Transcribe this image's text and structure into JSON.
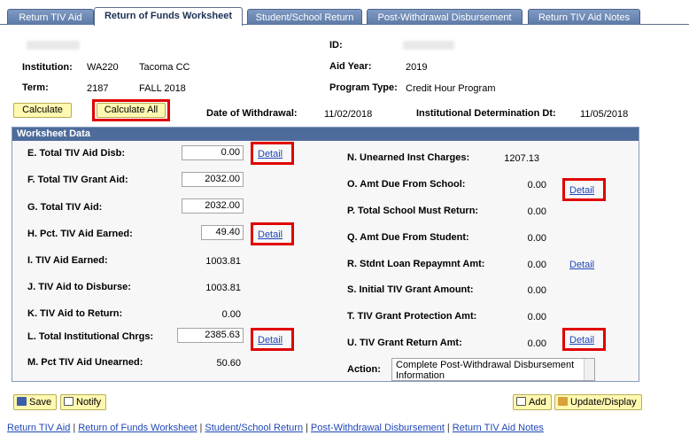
{
  "tabs": [
    {
      "label": "Return TIV Aid",
      "active": false
    },
    {
      "label": "Return of Funds Worksheet",
      "active": true
    },
    {
      "label": "Student/School Return",
      "active": false
    },
    {
      "label": "Post-Withdrawal Disbursement",
      "active": false
    },
    {
      "label": "Return TIV Aid Notes",
      "active": false
    }
  ],
  "header": {
    "id_label": "ID:",
    "institution_label": "Institution:",
    "institution_code": "WA220",
    "institution_name": "Tacoma CC",
    "aid_year_label": "Aid Year:",
    "aid_year": "2019",
    "term_label": "Term:",
    "term_code": "2187",
    "term_name": "FALL 2018",
    "program_type_label": "Program Type:",
    "program_type": "Credit Hour Program",
    "calculate_label": "Calculate",
    "calculate_all_label": "Calculate All",
    "withdrawal_label": "Date of Withdrawal:",
    "withdrawal_date": "11/02/2018",
    "inst_det_label": "Institutional Determination Dt:",
    "inst_det_date": "11/05/2018"
  },
  "worksheet": {
    "title": "Worksheet Data",
    "detail_label": "Detail",
    "E_label": "E. Total TIV Aid Disb:",
    "E_value": "0.00",
    "F_label": "F. Total TIV Grant Aid:",
    "F_value": "2032.00",
    "G_label": "G. Total TIV Aid:",
    "G_value": "2032.00",
    "H_label": "H. Pct. TIV Aid Earned:",
    "H_value": "49.40",
    "I_label": "I. TIV Aid Earned:",
    "I_value": "1003.81",
    "J_label": "J. TIV Aid to Disburse:",
    "J_value": "1003.81",
    "K_label": "K. TIV Aid to Return:",
    "K_value": "0.00",
    "L_label": "L. Total Institutional Chrgs:",
    "L_value": "2385.63",
    "M_label": "M. Pct TIV Aid Unearned:",
    "M_value": "50.60",
    "N_label": "N. Unearned Inst Charges:",
    "N_value": "1207.13",
    "O_label": "O. Amt Due From School:",
    "O_value": "0.00",
    "P_label": "P. Total School Must Return:",
    "P_value": "0.00",
    "Q_label": "Q. Amt Due From Student:",
    "Q_value": "0.00",
    "R_label": "R. Stdnt Loan Repaymnt Amt:",
    "R_value": "0.00",
    "S_label": "S. Initial TIV Grant Amount:",
    "S_value": "0.00",
    "T_label": "T. TIV Grant Protection Amt:",
    "T_value": "0.00",
    "U_label": "U. TIV Grant Return Amt:",
    "U_value": "0.00",
    "action_label": "Action:",
    "action_value": "Complete Post-Withdrawal Disbursement Information"
  },
  "toolbar": {
    "save_label": "Save",
    "notify_label": "Notify",
    "add_label": "Add",
    "update_label": "Update/Display"
  },
  "footer": {
    "links": [
      "Return TIV Aid",
      "Return of Funds Worksheet",
      "Student/School Return",
      "Post-Withdrawal Disbursement",
      "Return TIV Aid Notes"
    ]
  },
  "colors": {
    "tab_bg": "#6b88b5",
    "panel_header": "#4d6c9c",
    "button_bg": "#fff8b0",
    "link": "#1f47b8",
    "highlight": "#e00000"
  }
}
